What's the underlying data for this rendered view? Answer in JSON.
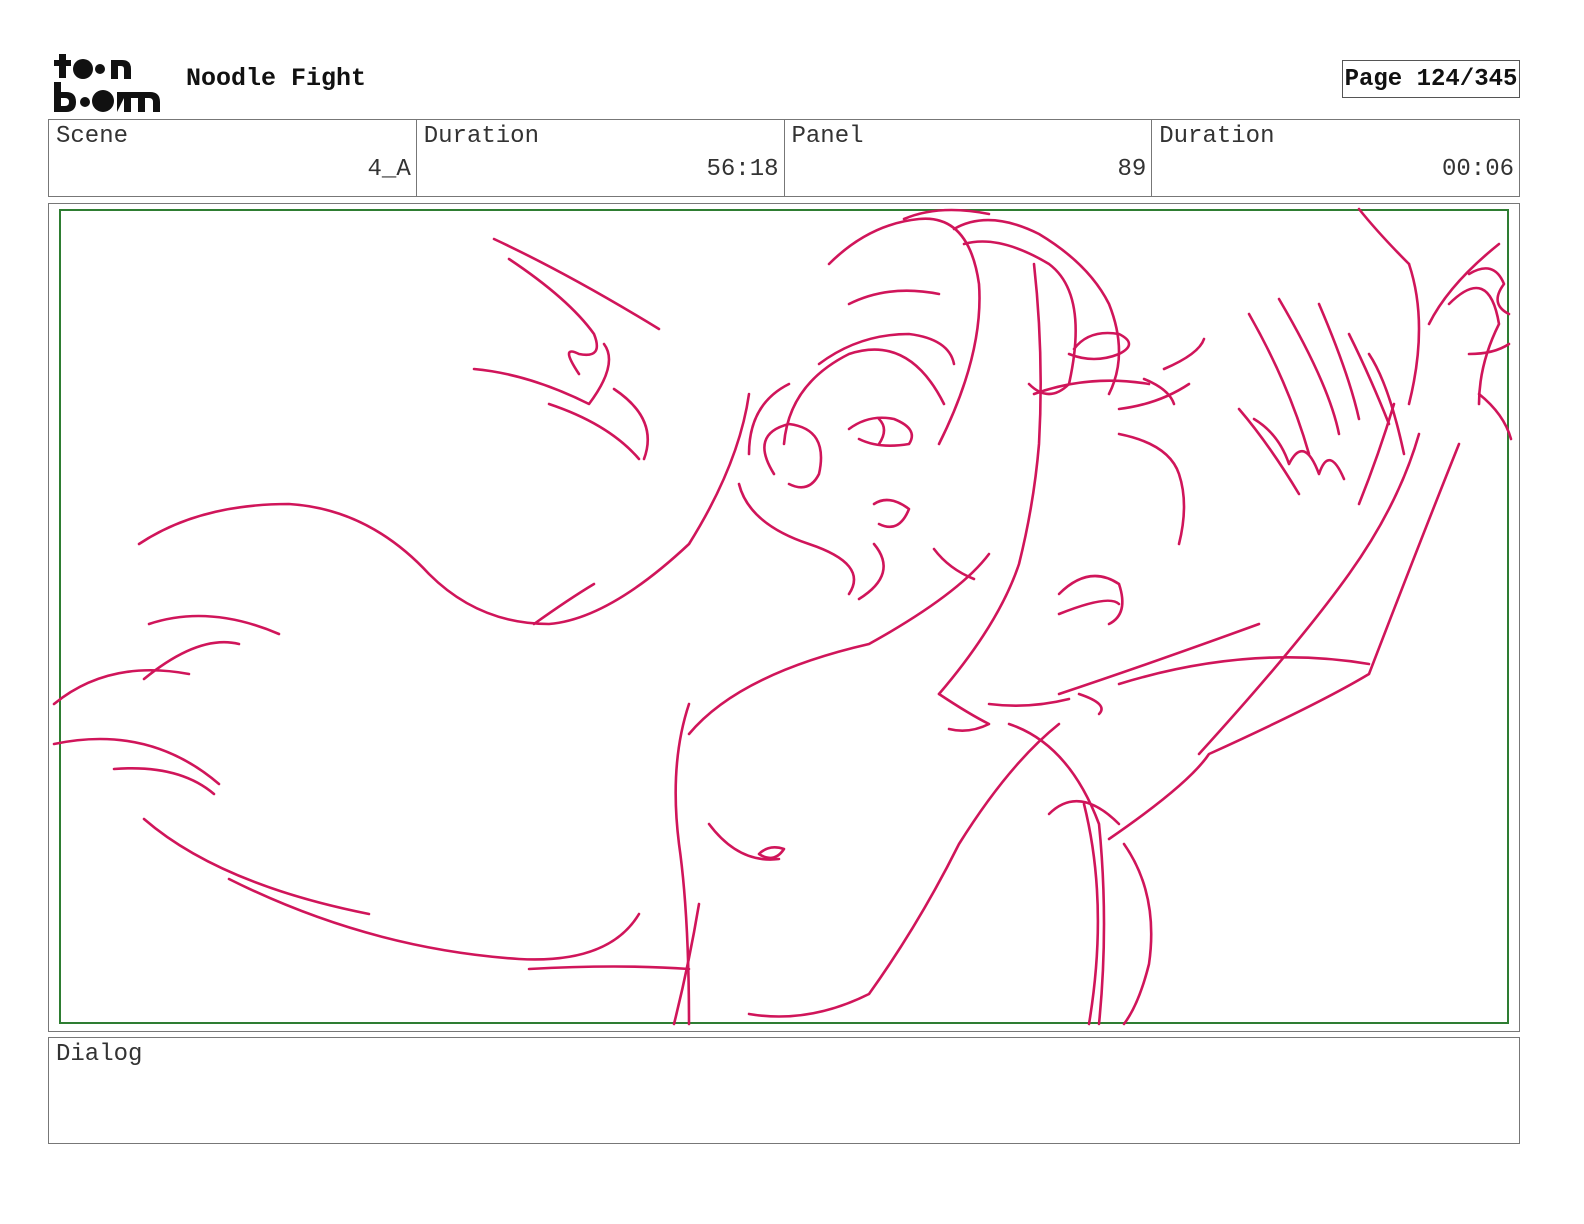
{
  "header": {
    "logo_text": "toon boom",
    "project_title": "Noodle Fight",
    "page_label": "Page 124/345"
  },
  "info": [
    {
      "label": "Scene",
      "value": "4_A"
    },
    {
      "label": "Duration",
      "value": "56:18"
    },
    {
      "label": "Panel",
      "value": "89"
    },
    {
      "label": "Duration",
      "value": "00:06"
    }
  ],
  "dialog": {
    "label": "Dialog",
    "text": ""
  },
  "colors": {
    "sketch": "#d0155a",
    "safe_frame": "#2e7d32",
    "border": "#777777"
  }
}
